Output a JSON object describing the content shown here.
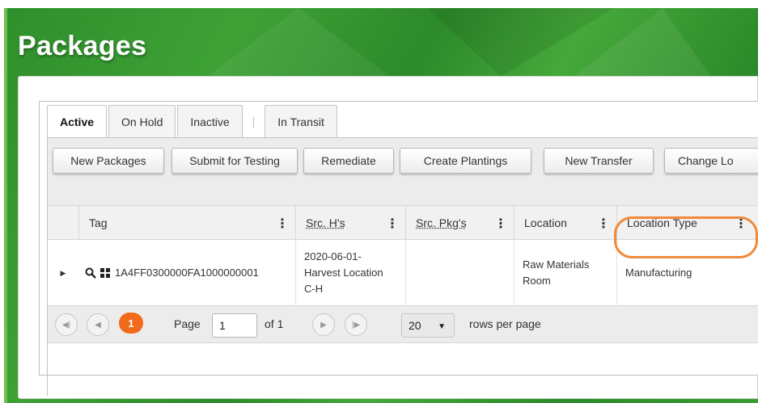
{
  "page": {
    "title": "Packages"
  },
  "tabs": [
    "Active",
    "On Hold",
    "Inactive",
    "|",
    "In Transit"
  ],
  "toolbar": {
    "buttons": [
      "New Packages",
      "Submit for Testing",
      "Remediate",
      "Create Plantings",
      "New Transfer",
      "Change Lo"
    ]
  },
  "grid": {
    "columns": [
      "Tag",
      "Src. H's",
      "Src. Pkg's",
      "Location",
      "Location Type"
    ],
    "rows": [
      {
        "tag": "1A4FF0300000FA1000000001",
        "src_h_line1": "2020-06-01-",
        "src_h_line2": "Harvest Location",
        "src_h_line3": "C-H",
        "src_pkg": "",
        "location_line1": "Raw Materials",
        "location_line2": "Room",
        "location_type": "Manufacturing"
      }
    ]
  },
  "pager": {
    "current_page": "1",
    "page_label": "Page",
    "page_value": "1",
    "of_label": "of 1",
    "rows_value": "20",
    "rows_label": "rows per page"
  },
  "colors": {
    "accent": "#f26a1b",
    "header_green": "#3a9b33",
    "highlight": "#f08a3a"
  }
}
